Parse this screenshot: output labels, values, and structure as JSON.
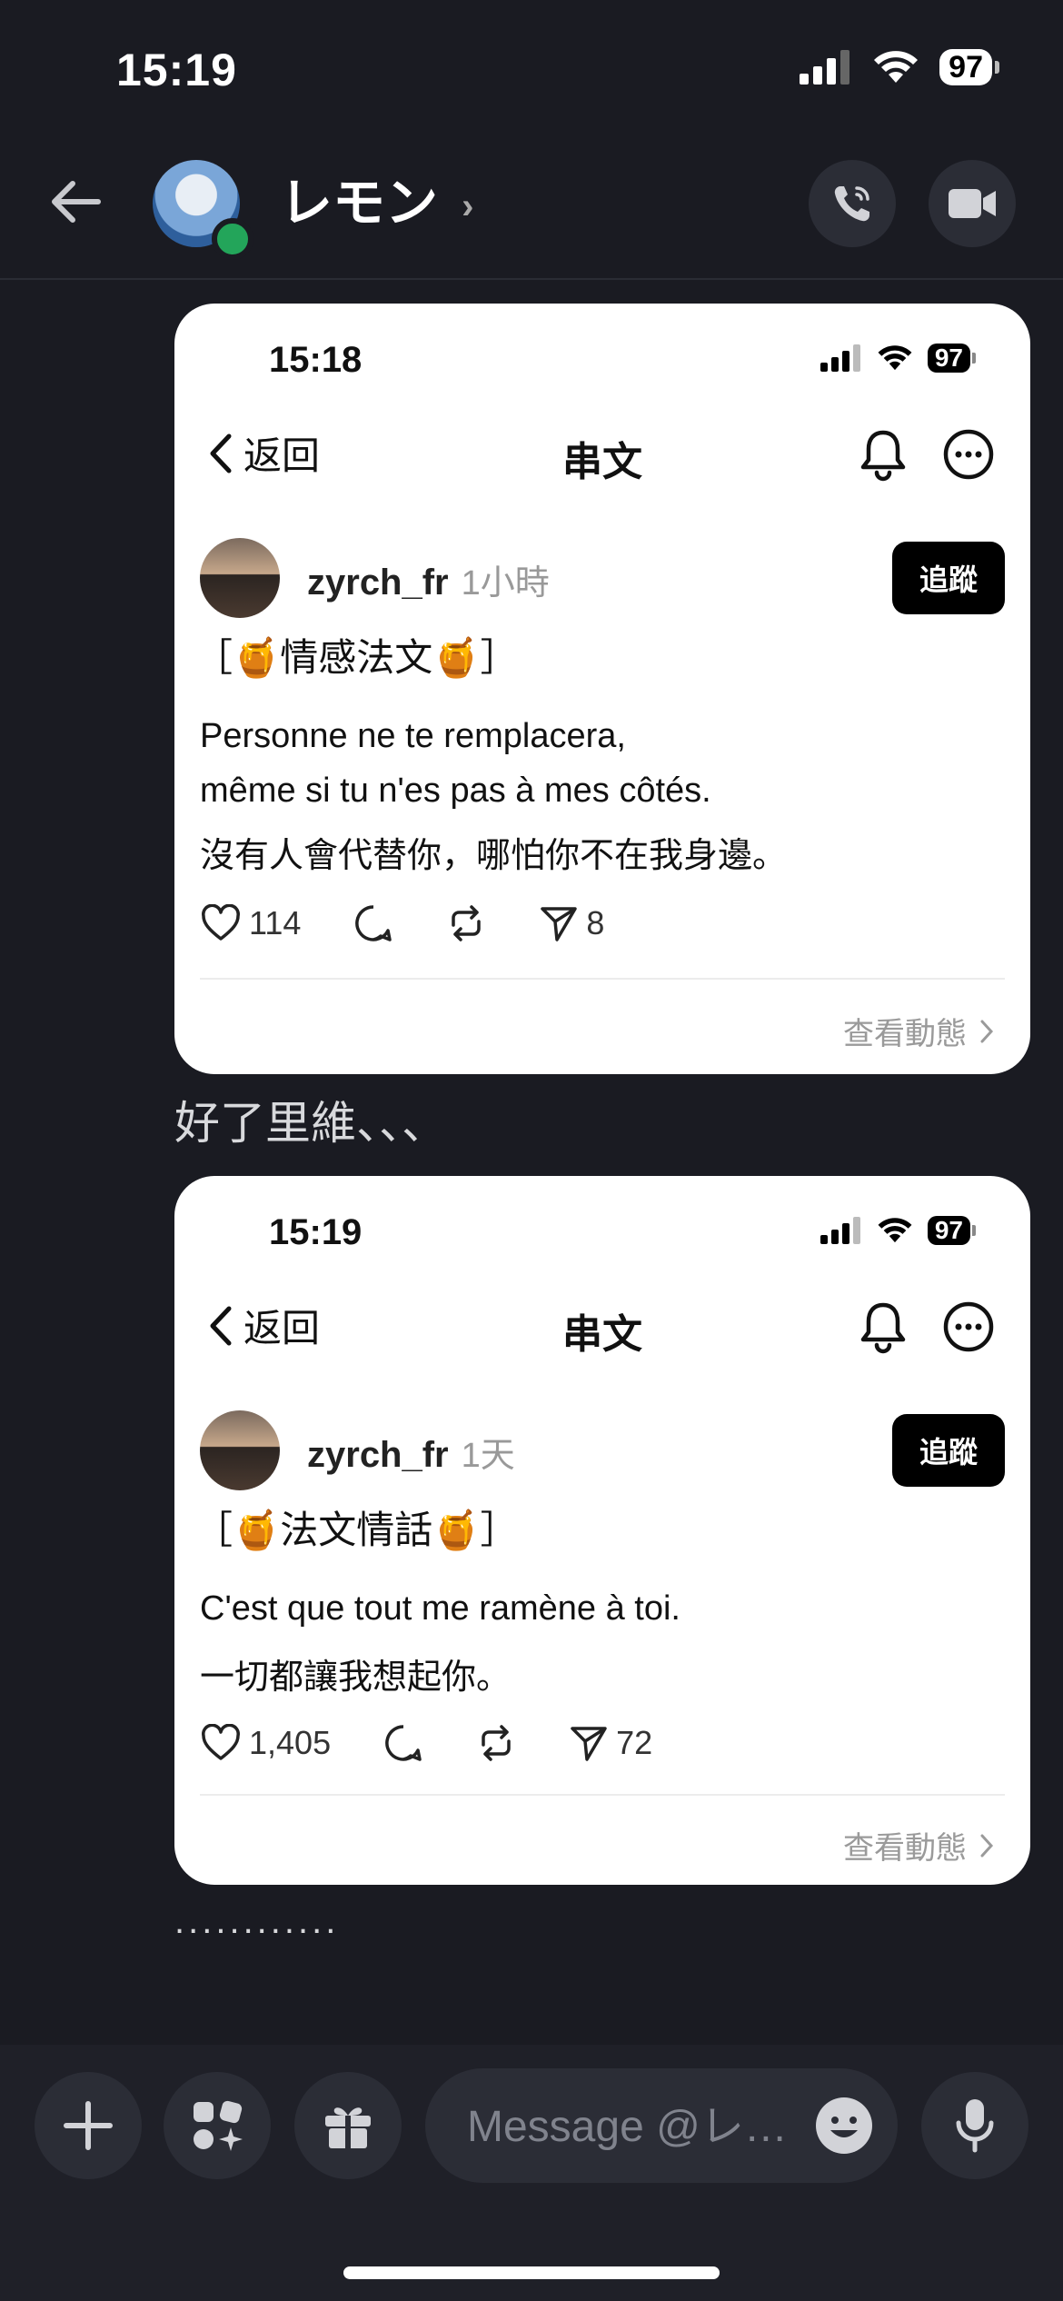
{
  "status": {
    "time": "15:19",
    "battery": "97"
  },
  "header": {
    "contact_name": "レモン",
    "chevron": "›"
  },
  "cards": [
    {
      "status_time": "15:18",
      "status_battery": "97",
      "back_label": "返回",
      "title": "串文",
      "username": "zyrch_fr",
      "time_ago": "1小時",
      "follow_label": "追蹤",
      "tag_line": "［🍯情感法文🍯］",
      "text_fr": "Personne ne te remplacera,\nmême si tu n'es pas à mes côtés.",
      "text_zh": "沒有人會代替你，哪怕你不在我身邊。",
      "likes": "114",
      "shares": "8",
      "view_label": "查看動態"
    },
    {
      "status_time": "15:19",
      "status_battery": "97",
      "back_label": "返回",
      "title": "串文",
      "username": "zyrch_fr",
      "time_ago": "1天",
      "follow_label": "追蹤",
      "tag_line": "［🍯法文情話🍯］",
      "text_fr": "C'est que tout me ramène à toi.",
      "text_zh": "一切都讓我想起你。",
      "likes": "1,405",
      "shares": "72",
      "view_label": "查看動態"
    }
  ],
  "messages": {
    "text1": "好了里維、、、",
    "text2": "............"
  },
  "composer": {
    "placeholder": "Message @レ…"
  }
}
